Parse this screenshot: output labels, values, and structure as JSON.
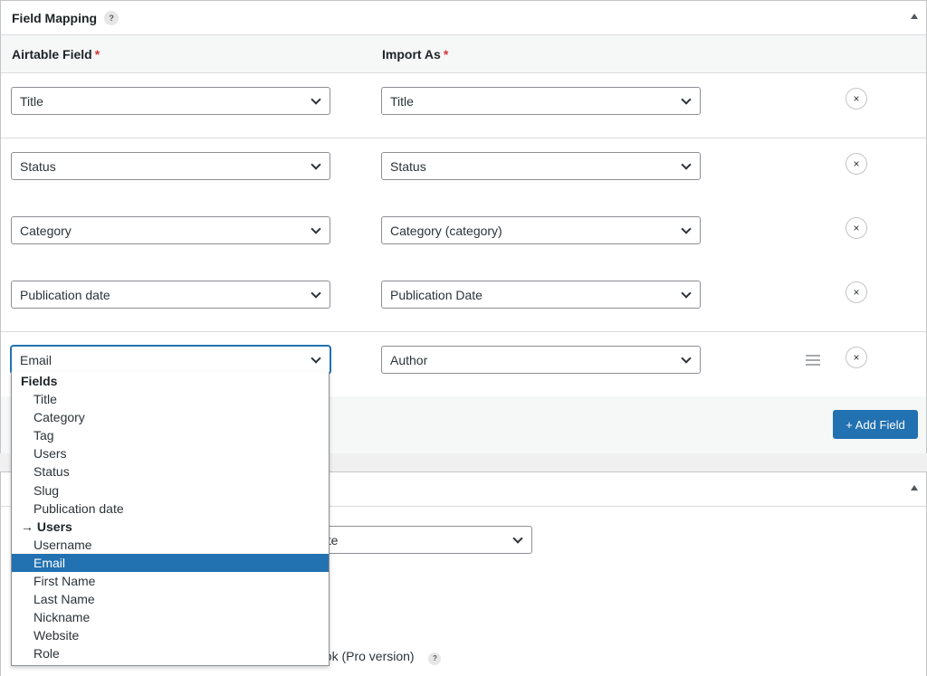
{
  "panel1": {
    "title": "Field Mapping",
    "help": "?",
    "columns": {
      "airtable_field": "Airtable Field",
      "import_as": "Import As",
      "required_mark": "*"
    },
    "rows": [
      {
        "airtable": "Title",
        "import_as": "Title"
      },
      {
        "airtable": "Status",
        "import_as": "Status"
      },
      {
        "airtable": "Category",
        "import_as": "Category (category)"
      },
      {
        "airtable": "Publication date",
        "import_as": "Publication Date"
      },
      {
        "airtable": "Email",
        "import_as": "Author"
      }
    ],
    "remove_glyph": "×",
    "add_button": "+ Add Field"
  },
  "panel2": {
    "select_partial": "ete",
    "text_partial": "ook (Pro version)",
    "help": "?"
  },
  "dropdown": {
    "items": [
      {
        "label": "Fields",
        "type": "group"
      },
      {
        "label": "Title",
        "type": "option"
      },
      {
        "label": "Category",
        "type": "option"
      },
      {
        "label": "Tag",
        "type": "option"
      },
      {
        "label": "Users",
        "type": "option"
      },
      {
        "label": "Status",
        "type": "option"
      },
      {
        "label": "Slug",
        "type": "option"
      },
      {
        "label": "Publication date",
        "type": "option"
      },
      {
        "label": "→ Users",
        "type": "group"
      },
      {
        "label": "Username",
        "type": "option"
      },
      {
        "label": "Email",
        "type": "option",
        "selected": true
      },
      {
        "label": "First Name",
        "type": "option"
      },
      {
        "label": "Last Name",
        "type": "option"
      },
      {
        "label": "Nickname",
        "type": "option"
      },
      {
        "label": "Website",
        "type": "option"
      },
      {
        "label": "Role",
        "type": "option"
      }
    ]
  },
  "colors": {
    "accent": "#2271b1",
    "required": "#d63638"
  }
}
